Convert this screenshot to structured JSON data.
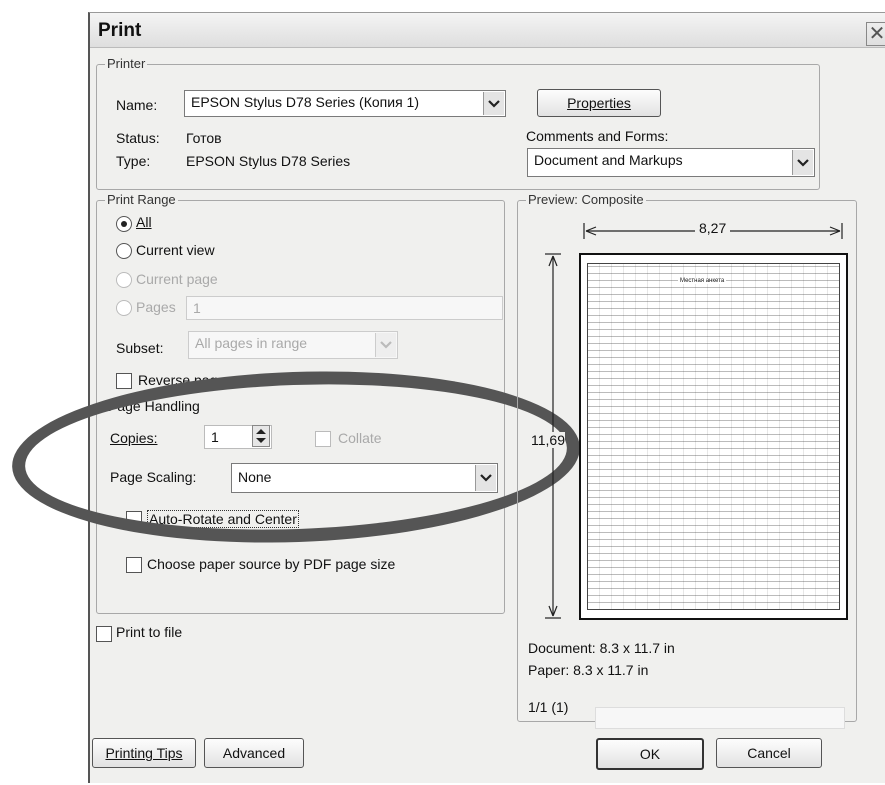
{
  "dialog": {
    "title": "Print",
    "close_glyph": "✕"
  },
  "printer": {
    "group_label": "Printer",
    "name_label": "Name:",
    "name_value": "EPSON Stylus D78 Series (Копия 1)",
    "properties_label": "Properties",
    "status_label": "Status:",
    "status_value": "Готов",
    "type_label": "Type:",
    "type_value": "EPSON Stylus D78 Series",
    "comments_label": "Comments and Forms:",
    "comments_value": "Document and Markups"
  },
  "print_range": {
    "group_label": "Print Range",
    "all_label": "All",
    "current_view_label": "Current view",
    "current_page_label": "Current page",
    "pages_label": "Pages",
    "pages_value": "1",
    "subset_label": "Subset:",
    "subset_value": "All pages in range",
    "reverse_label": "Reverse pages"
  },
  "page_handling": {
    "group_label": "Page Handling",
    "copies_label": "Copies:",
    "copies_value": "1",
    "collate_label": "Collate",
    "scaling_label": "Page Scaling:",
    "scaling_value": "None",
    "autorotate_label": "Auto-Rotate and Center",
    "paper_source_label": "Choose paper source by PDF page size"
  },
  "print_to_file_label": "Print to file",
  "preview": {
    "group_label": "Preview: Composite",
    "width_label": "8,27",
    "height_label": "11,69",
    "doc_title": "Местная анкета",
    "document_size": "Document: 8.3 x 11.7 in",
    "paper_size": "Paper: 8.3 x 11.7 in",
    "page_counter": "1/1 (1)"
  },
  "footer": {
    "tips_label": "Printing Tips",
    "advanced_label": "Advanced",
    "ok_label": "OK",
    "cancel_label": "Cancel"
  },
  "icons": {
    "dropdown": "chevron-down-icon",
    "spinner": "up-down-spinner-icon"
  },
  "colors": {
    "annotation_ellipse": "#555555",
    "background": "#f0f0ee"
  }
}
